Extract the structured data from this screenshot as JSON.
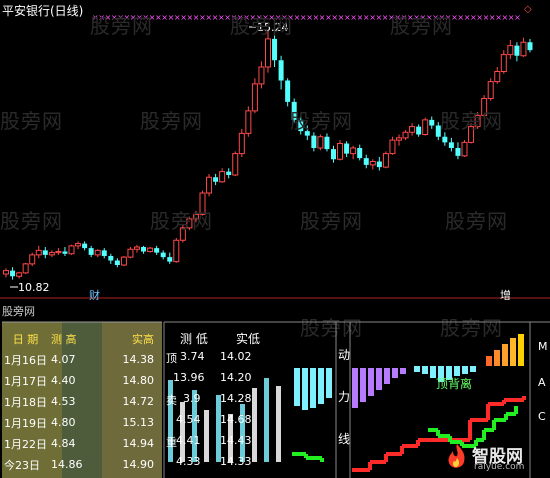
{
  "chart": {
    "title": "平安银行(日线)",
    "high_label": "15.24",
    "low_label": "10.82",
    "tag_cai": "财",
    "tag_zeng": "增",
    "watermark": "股旁网",
    "bottom_watermark": "股旁网",
    "colors": {
      "up": "#ff4a4a",
      "down": "#54ffff",
      "marker": "#ff55ff",
      "bg": "#000000"
    },
    "candles": [
      [
        10.92,
        11.02,
        10.86,
        10.98
      ],
      [
        10.98,
        11.04,
        10.82,
        10.88
      ],
      [
        10.88,
        10.96,
        10.84,
        10.94
      ],
      [
        10.94,
        11.12,
        10.92,
        11.1
      ],
      [
        11.1,
        11.3,
        11.06,
        11.26
      ],
      [
        11.26,
        11.42,
        11.2,
        11.34
      ],
      [
        11.34,
        11.4,
        11.2,
        11.26
      ],
      [
        11.26,
        11.34,
        11.22,
        11.3
      ],
      [
        11.3,
        11.38,
        11.26,
        11.32
      ],
      [
        11.32,
        11.4,
        11.24,
        11.28
      ],
      [
        11.28,
        11.44,
        11.26,
        11.42
      ],
      [
        11.42,
        11.5,
        11.36,
        11.46
      ],
      [
        11.46,
        11.5,
        11.34,
        11.38
      ],
      [
        11.38,
        11.42,
        11.22,
        11.26
      ],
      [
        11.26,
        11.36,
        11.22,
        11.34
      ],
      [
        11.34,
        11.38,
        11.2,
        11.24
      ],
      [
        11.24,
        11.28,
        11.1,
        11.16
      ],
      [
        11.16,
        11.2,
        11.04,
        11.08
      ],
      [
        11.08,
        11.24,
        11.06,
        11.22
      ],
      [
        11.22,
        11.4,
        11.2,
        11.36
      ],
      [
        11.36,
        11.44,
        11.3,
        11.4
      ],
      [
        11.4,
        11.42,
        11.28,
        11.32
      ],
      [
        11.32,
        11.4,
        11.3,
        11.38
      ],
      [
        11.38,
        11.42,
        11.26,
        11.3
      ],
      [
        11.3,
        11.34,
        11.18,
        11.22
      ],
      [
        11.22,
        11.3,
        11.1,
        11.14
      ],
      [
        11.14,
        11.56,
        11.12,
        11.52
      ],
      [
        11.52,
        11.8,
        11.48,
        11.74
      ],
      [
        11.74,
        11.94,
        11.7,
        11.9
      ],
      [
        11.9,
        12.04,
        11.84,
        11.98
      ],
      [
        11.98,
        12.4,
        11.96,
        12.36
      ],
      [
        12.36,
        12.7,
        12.3,
        12.64
      ],
      [
        12.64,
        12.7,
        12.5,
        12.56
      ],
      [
        12.56,
        12.8,
        12.54,
        12.74
      ],
      [
        12.74,
        12.8,
        12.62,
        12.68
      ],
      [
        12.68,
        13.1,
        12.66,
        13.06
      ],
      [
        13.06,
        13.5,
        13.0,
        13.42
      ],
      [
        13.42,
        13.9,
        13.36,
        13.82
      ],
      [
        13.82,
        14.4,
        13.78,
        14.3
      ],
      [
        14.3,
        14.7,
        14.22,
        14.6
      ],
      [
        14.6,
        15.24,
        14.5,
        15.1
      ],
      [
        15.1,
        15.16,
        14.6,
        14.72
      ],
      [
        14.72,
        14.8,
        14.2,
        14.36
      ],
      [
        14.36,
        14.4,
        13.9,
        13.98
      ],
      [
        13.98,
        14.04,
        13.6,
        13.66
      ],
      [
        13.66,
        13.74,
        13.4,
        13.46
      ],
      [
        13.46,
        13.56,
        13.3,
        13.38
      ],
      [
        13.38,
        13.44,
        13.1,
        13.16
      ],
      [
        13.16,
        13.4,
        13.12,
        13.36
      ],
      [
        13.36,
        13.42,
        13.1,
        13.14
      ],
      [
        13.14,
        13.2,
        12.9,
        12.96
      ],
      [
        12.96,
        13.3,
        12.94,
        13.24
      ],
      [
        13.24,
        13.28,
        13.0,
        13.06
      ],
      [
        13.06,
        13.2,
        12.96,
        13.16
      ],
      [
        13.16,
        13.22,
        12.94,
        12.98
      ],
      [
        12.98,
        13.04,
        12.8,
        12.86
      ],
      [
        12.86,
        12.96,
        12.78,
        12.92
      ],
      [
        12.92,
        13.0,
        12.76,
        12.82
      ],
      [
        12.82,
        13.1,
        12.8,
        13.06
      ],
      [
        13.06,
        13.36,
        13.04,
        13.3
      ],
      [
        13.3,
        13.4,
        13.2,
        13.34
      ],
      [
        13.34,
        13.48,
        13.3,
        13.44
      ],
      [
        13.44,
        13.6,
        13.38,
        13.54
      ],
      [
        13.54,
        13.58,
        13.36,
        13.4
      ],
      [
        13.4,
        13.7,
        13.38,
        13.66
      ],
      [
        13.66,
        13.72,
        13.5,
        13.56
      ],
      [
        13.56,
        13.62,
        13.3,
        13.36
      ],
      [
        13.36,
        13.44,
        13.2,
        13.26
      ],
      [
        13.26,
        13.34,
        13.1,
        13.16
      ],
      [
        13.16,
        13.26,
        12.96,
        13.02
      ],
      [
        13.02,
        13.3,
        13.0,
        13.26
      ],
      [
        13.26,
        13.6,
        13.24,
        13.54
      ],
      [
        13.54,
        13.8,
        13.5,
        13.74
      ],
      [
        13.74,
        14.1,
        13.7,
        14.04
      ],
      [
        14.04,
        14.4,
        14.0,
        14.34
      ],
      [
        14.34,
        14.6,
        14.3,
        14.52
      ],
      [
        14.52,
        14.9,
        14.48,
        14.82
      ],
      [
        14.82,
        15.08,
        14.74,
        14.98
      ],
      [
        14.98,
        15.04,
        14.7,
        14.8
      ],
      [
        14.8,
        15.12,
        14.78,
        15.04
      ],
      [
        15.04,
        15.1,
        14.86,
        14.9
      ]
    ]
  },
  "panel": {
    "title": "股旁网",
    "headers": {
      "date": "日 期",
      "pred_high": "测 高",
      "actual_high": "实高",
      "pred_low": "测 低",
      "actual_low": "实低"
    },
    "rows": [
      {
        "date": "1月16日",
        "pred_high": "4.07",
        "actual_high": "14.38",
        "pred_low": "3.74",
        "actual_low": "14.02"
      },
      {
        "date": "1月17日",
        "pred_high": "4.40",
        "actual_high": "14.80",
        "pred_low": "13.96",
        "actual_low": "14.20"
      },
      {
        "date": "1月18日",
        "pred_high": "4.53",
        "actual_high": "14.72",
        "pred_low": "3.9",
        "actual_low": "14.28"
      },
      {
        "date": "1月19日",
        "pred_high": "4.80",
        "actual_high": "15.13",
        "pred_low": "4.54",
        "actual_low": "14.68"
      },
      {
        "date": "1月22日",
        "pred_high": "4.84",
        "actual_high": "14.94",
        "pred_low": "4.41",
        "actual_low": "14.43"
      },
      {
        "date": "今23日",
        "pred_high": "14.86",
        "actual_high": "14.90",
        "pred_low": "4.33",
        "actual_low": "14.33"
      }
    ],
    "side_chars": [
      "动",
      "力",
      "线"
    ],
    "row_tags": [
      "顶",
      "卖",
      "重"
    ],
    "right_labels": [
      "M",
      "A",
      "C"
    ],
    "divergence_label": "顶背离",
    "logo": {
      "name": "智股网",
      "url": "raiyue.com"
    }
  }
}
